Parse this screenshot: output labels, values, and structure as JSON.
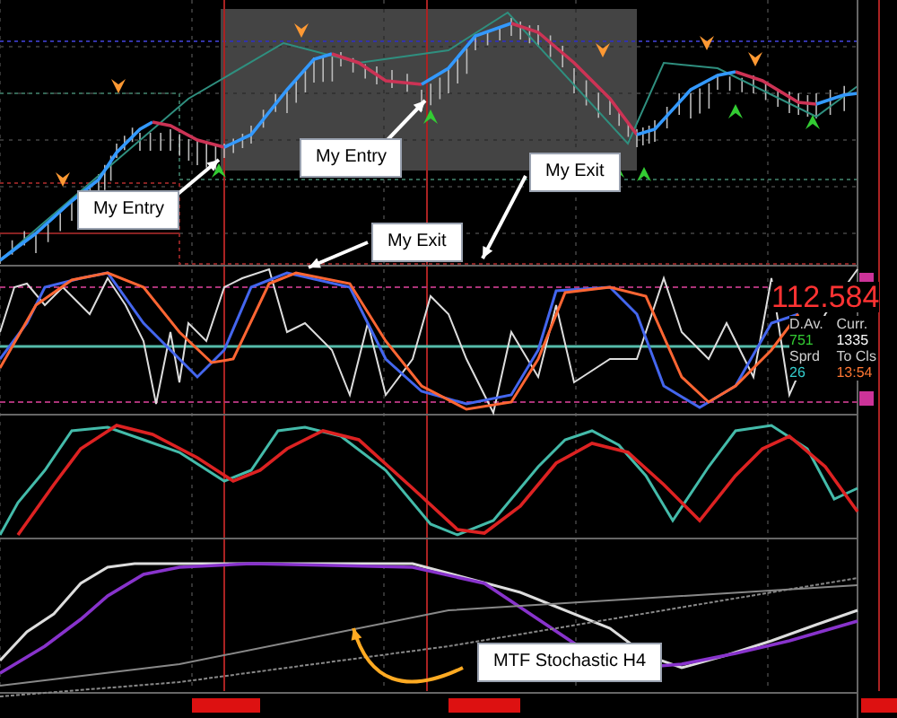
{
  "callouts": [
    {
      "text": "My Entry"
    },
    {
      "text": "My Entry"
    },
    {
      "text": "My Exit"
    },
    {
      "text": "My Exit"
    },
    {
      "text": "MTF Stochastic H4"
    }
  ],
  "readout": {
    "price": "112.584",
    "cells": [
      {
        "text": "D.Av.",
        "color": "#d0d0d0"
      },
      {
        "text": "Curr.",
        "color": "#d0d0d0"
      },
      {
        "text": "751",
        "color": "#33cc33"
      },
      {
        "text": "1335",
        "color": "#ffffff"
      },
      {
        "text": "Sprd",
        "color": "#d0d0d0"
      },
      {
        "text": "To Cls",
        "color": "#d0d0d0"
      },
      {
        "text": "26",
        "color": "#33cccc"
      },
      {
        "text": "13:54",
        "color": "#ff7733"
      }
    ]
  }
}
